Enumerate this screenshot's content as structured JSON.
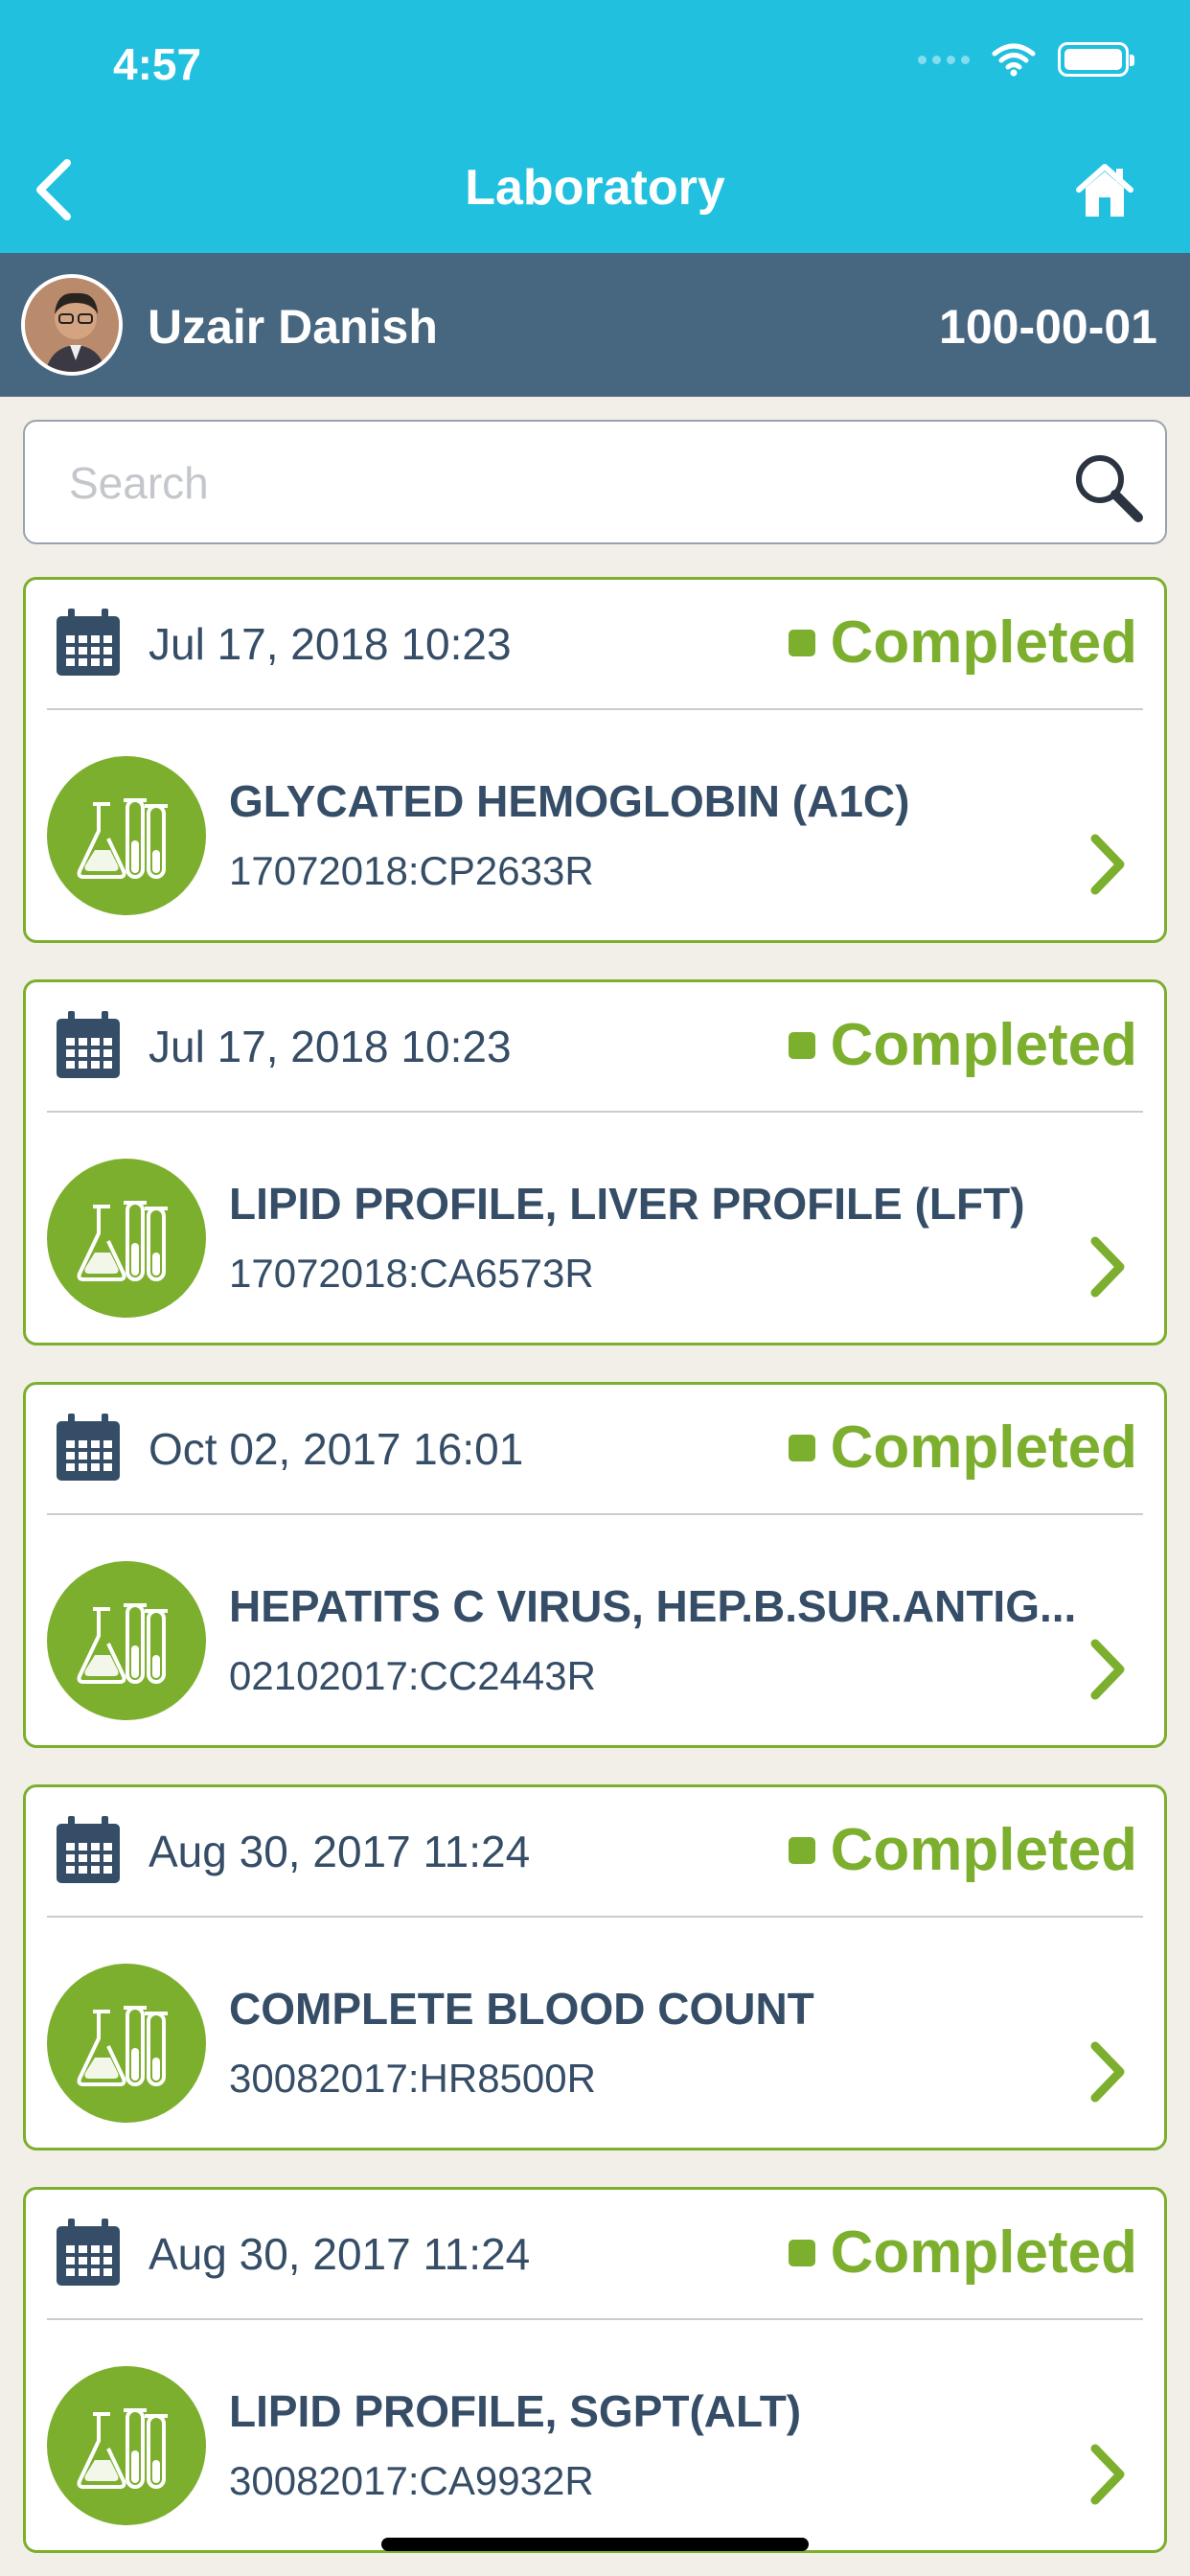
{
  "status_bar": {
    "time": "4:57"
  },
  "nav": {
    "title": "Laboratory",
    "back_icon": "chevron-left-icon",
    "home_icon": "home-icon"
  },
  "patient": {
    "name": "Uzair Danish",
    "id": "100-00-01"
  },
  "search": {
    "placeholder": "Search",
    "value": ""
  },
  "colors": {
    "header": "#22c0df",
    "patient_bar": "#476680",
    "accent": "#7caf2e",
    "text": "#354d66"
  },
  "records": [
    {
      "date": "Jul 17, 2018 10:23",
      "status": "Completed",
      "test": "GLYCATED HEMOGLOBIN (A1C)",
      "code": "17072018:CP2633R"
    },
    {
      "date": "Jul 17, 2018 10:23",
      "status": "Completed",
      "test": "LIPID PROFILE, LIVER PROFILE (LFT)",
      "code": "17072018:CA6573R"
    },
    {
      "date": "Oct 02, 2017 16:01",
      "status": "Completed",
      "test": "HEPATITS C VIRUS, HEP.B.SUR.ANTIG...",
      "code": "02102017:CC2443R"
    },
    {
      "date": "Aug 30, 2017 11:24",
      "status": "Completed",
      "test": "COMPLETE BLOOD COUNT",
      "code": "30082017:HR8500R"
    },
    {
      "date": "Aug 30, 2017 11:24",
      "status": "Completed",
      "test": "LIPID PROFILE, SGPT(ALT)",
      "code": "30082017:CA9932R"
    }
  ]
}
